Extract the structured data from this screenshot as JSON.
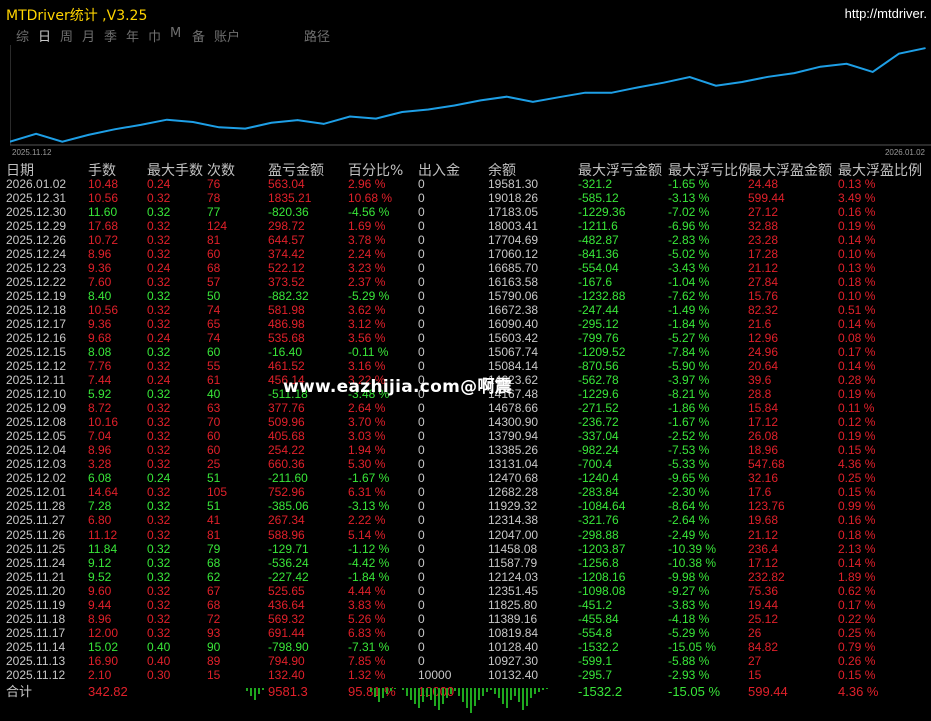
{
  "window": {
    "title": "MTDriver统计 ,V3.25",
    "url": "http://mtdriver."
  },
  "tabs": [
    "综",
    "日",
    "周",
    "月",
    "季",
    "年",
    "巾",
    "M",
    "备",
    "账户",
    "路径"
  ],
  "active_tab": 1,
  "chart_data": {
    "type": "line",
    "x_start_label": "2025.11.12",
    "x_end_label": "2026.01.02",
    "x": [
      "2025.11.12",
      "2025.11.13",
      "2025.11.14",
      "2025.11.17",
      "2025.11.18",
      "2025.11.19",
      "2025.11.20",
      "2025.11.21",
      "2025.11.24",
      "2025.11.25",
      "2025.11.26",
      "2025.11.27",
      "2025.11.28",
      "2025.12.01",
      "2025.12.02",
      "2025.12.03",
      "2025.12.04",
      "2025.12.05",
      "2025.12.08",
      "2025.12.09",
      "2025.12.10",
      "2025.12.11",
      "2025.12.12",
      "2025.12.15",
      "2025.12.16",
      "2025.12.17",
      "2025.12.18",
      "2025.12.19",
      "2025.12.22",
      "2025.12.23",
      "2025.12.24",
      "2025.12.26",
      "2025.12.29",
      "2025.12.30",
      "2025.12.31",
      "2026.01.02"
    ],
    "values": [
      10132.4,
      10927.3,
      10128.4,
      10819.84,
      11389.16,
      11825.8,
      12351.45,
      12124.03,
      11587.79,
      11458.08,
      12047.0,
      12314.38,
      11929.32,
      12682.28,
      12470.68,
      13131.04,
      13385.26,
      13790.94,
      14300.9,
      14678.66,
      14167.48,
      14623.62,
      15084.14,
      15067.74,
      15603.42,
      16090.4,
      16672.38,
      15790.06,
      16163.58,
      16685.7,
      17060.12,
      17704.69,
      18003.41,
      17183.05,
      19018.26,
      19581.3
    ],
    "ylim": [
      9800,
      19900
    ],
    "line_color": "#1e9fe6"
  },
  "headers": [
    "日期",
    "手数",
    "最大手数",
    "次数",
    "盈亏金额",
    "百分比%",
    "出入金",
    "余额",
    "最大浮亏金额",
    "最大浮亏比例",
    "最大浮盈金额",
    "最大浮盈比例"
  ],
  "rows": [
    [
      "2026.01.02",
      "10.48",
      "0.24",
      "76",
      "563.04",
      "2.96 %",
      "0",
      "19581.30",
      "-321.2",
      "-1.65 %",
      "24.48",
      "0.13 %"
    ],
    [
      "2025.12.31",
      "10.56",
      "0.32",
      "78",
      "1835.21",
      "10.68 %",
      "0",
      "19018.26",
      "-585.12",
      "-3.13 %",
      "599.44",
      "3.49 %"
    ],
    [
      "2025.12.30",
      "11.60",
      "0.32",
      "77",
      "-820.36",
      "-4.56 %",
      "0",
      "17183.05",
      "-1229.36",
      "-7.02 %",
      "27.12",
      "0.16 %"
    ],
    [
      "2025.12.29",
      "17.68",
      "0.32",
      "124",
      "298.72",
      "1.69 %",
      "0",
      "18003.41",
      "-1211.6",
      "-6.96 %",
      "32.88",
      "0.19 %"
    ],
    [
      "2025.12.26",
      "10.72",
      "0.32",
      "81",
      "644.57",
      "3.78 %",
      "0",
      "17704.69",
      "-482.87",
      "-2.83 %",
      "23.28",
      "0.14 %"
    ],
    [
      "2025.12.24",
      "8.96",
      "0.32",
      "60",
      "374.42",
      "2.24 %",
      "0",
      "17060.12",
      "-841.36",
      "-5.02 %",
      "17.28",
      "0.10 %"
    ],
    [
      "2025.12.23",
      "9.36",
      "0.24",
      "68",
      "522.12",
      "3.23 %",
      "0",
      "16685.70",
      "-554.04",
      "-3.43 %",
      "21.12",
      "0.13 %"
    ],
    [
      "2025.12.22",
      "7.60",
      "0.32",
      "57",
      "373.52",
      "2.37 %",
      "0",
      "16163.58",
      "-167.6",
      "-1.04 %",
      "27.84",
      "0.18 %"
    ],
    [
      "2025.12.19",
      "8.40",
      "0.32",
      "50",
      "-882.32",
      "-5.29 %",
      "0",
      "15790.06",
      "-1232.88",
      "-7.62 %",
      "15.76",
      "0.10 %"
    ],
    [
      "2025.12.18",
      "10.56",
      "0.32",
      "74",
      "581.98",
      "3.62 %",
      "0",
      "16672.38",
      "-247.44",
      "-1.49 %",
      "82.32",
      "0.51 %"
    ],
    [
      "2025.12.17",
      "9.36",
      "0.32",
      "65",
      "486.98",
      "3.12 %",
      "0",
      "16090.40",
      "-295.12",
      "-1.84 %",
      "21.6",
      "0.14 %"
    ],
    [
      "2025.12.16",
      "9.68",
      "0.24",
      "74",
      "535.68",
      "3.56 %",
      "0",
      "15603.42",
      "-799.76",
      "-5.27 %",
      "12.96",
      "0.08 %"
    ],
    [
      "2025.12.15",
      "8.08",
      "0.32",
      "60",
      "-16.40",
      "-0.11 %",
      "0",
      "15067.74",
      "-1209.52",
      "-7.84 %",
      "24.96",
      "0.17 %"
    ],
    [
      "2025.12.12",
      "7.76",
      "0.32",
      "55",
      "461.52",
      "3.16 %",
      "0",
      "15084.14",
      "-870.56",
      "-5.90 %",
      "20.64",
      "0.14 %"
    ],
    [
      "2025.12.11",
      "7.44",
      "0.24",
      "61",
      "456.14",
      "3.22 %",
      "0",
      "14623.62",
      "-562.78",
      "-3.97 %",
      "39.6",
      "0.28 %"
    ],
    [
      "2025.12.10",
      "5.92",
      "0.32",
      "40",
      "-511.18",
      "-3.48 %",
      "0",
      "14167.48",
      "-1229.6",
      "-8.21 %",
      "28.8",
      "0.19 %"
    ],
    [
      "2025.12.09",
      "8.72",
      "0.32",
      "63",
      "377.76",
      "2.64 %",
      "0",
      "14678.66",
      "-271.52",
      "-1.86 %",
      "15.84",
      "0.11 %"
    ],
    [
      "2025.12.08",
      "10.16",
      "0.32",
      "70",
      "509.96",
      "3.70 %",
      "0",
      "14300.90",
      "-236.72",
      "-1.67 %",
      "17.12",
      "0.12 %"
    ],
    [
      "2025.12.05",
      "7.04",
      "0.32",
      "60",
      "405.68",
      "3.03 %",
      "0",
      "13790.94",
      "-337.04",
      "-2.52 %",
      "26.08",
      "0.19 %"
    ],
    [
      "2025.12.04",
      "8.96",
      "0.32",
      "60",
      "254.22",
      "1.94 %",
      "0",
      "13385.26",
      "-982.24",
      "-7.53 %",
      "18.96",
      "0.15 %"
    ],
    [
      "2025.12.03",
      "3.28",
      "0.32",
      "25",
      "660.36",
      "5.30 %",
      "0",
      "13131.04",
      "-700.4",
      "-5.33 %",
      "547.68",
      "4.36 %"
    ],
    [
      "2025.12.02",
      "6.08",
      "0.24",
      "51",
      "-211.60",
      "-1.67 %",
      "0",
      "12470.68",
      "-1240.4",
      "-9.65 %",
      "32.16",
      "0.25 %"
    ],
    [
      "2025.12.01",
      "14.64",
      "0.32",
      "105",
      "752.96",
      "6.31 %",
      "0",
      "12682.28",
      "-283.84",
      "-2.30 %",
      "17.6",
      "0.15 %"
    ],
    [
      "2025.11.28",
      "7.28",
      "0.32",
      "51",
      "-385.06",
      "-3.13 %",
      "0",
      "11929.32",
      "-1084.64",
      "-8.64 %",
      "123.76",
      "0.99 %"
    ],
    [
      "2025.11.27",
      "6.80",
      "0.32",
      "41",
      "267.34",
      "2.22 %",
      "0",
      "12314.38",
      "-321.76",
      "-2.64 %",
      "19.68",
      "0.16 %"
    ],
    [
      "2025.11.26",
      "11.12",
      "0.32",
      "81",
      "588.96",
      "5.14 %",
      "0",
      "12047.00",
      "-298.88",
      "-2.49 %",
      "21.12",
      "0.18 %"
    ],
    [
      "2025.11.25",
      "11.84",
      "0.32",
      "79",
      "-129.71",
      "-1.12 %",
      "0",
      "11458.08",
      "-1203.87",
      "-10.39 %",
      "236.4",
      "2.13 %"
    ],
    [
      "2025.11.24",
      "9.12",
      "0.32",
      "68",
      "-536.24",
      "-4.42 %",
      "0",
      "11587.79",
      "-1256.8",
      "-10.38 %",
      "17.12",
      "0.14 %"
    ],
    [
      "2025.11.21",
      "9.52",
      "0.32",
      "62",
      "-227.42",
      "-1.84 %",
      "0",
      "12124.03",
      "-1208.16",
      "-9.98 %",
      "232.82",
      "1.89 %"
    ],
    [
      "2025.11.20",
      "9.60",
      "0.32",
      "67",
      "525.65",
      "4.44 %",
      "0",
      "12351.45",
      "-1098.08",
      "-9.27 %",
      "75.36",
      "0.62 %"
    ],
    [
      "2025.11.19",
      "9.44",
      "0.32",
      "68",
      "436.64",
      "3.83 %",
      "0",
      "11825.80",
      "-451.2",
      "-3.83 %",
      "19.44",
      "0.17 %"
    ],
    [
      "2025.11.18",
      "8.96",
      "0.32",
      "72",
      "569.32",
      "5.26 %",
      "0",
      "11389.16",
      "-455.84",
      "-4.18 %",
      "25.12",
      "0.22 %"
    ],
    [
      "2025.11.17",
      "12.00",
      "0.32",
      "93",
      "691.44",
      "6.83 %",
      "0",
      "10819.84",
      "-554.8",
      "-5.29 %",
      "26",
      "0.25 %"
    ],
    [
      "2025.11.14",
      "15.02",
      "0.40",
      "90",
      "-798.90",
      "-7.31 %",
      "0",
      "10128.40",
      "-1532.2",
      "-15.05 %",
      "84.82",
      "0.79 %"
    ],
    [
      "2025.11.13",
      "16.90",
      "0.40",
      "89",
      "794.90",
      "7.85 %",
      "0",
      "10927.30",
      "-599.1",
      "-5.88 %",
      "27",
      "0.26 %"
    ],
    [
      "2025.11.12",
      "2.10",
      "0.30",
      "15",
      "132.40",
      "1.32 %",
      "10000",
      "10132.40",
      "-295.7",
      "-2.93 %",
      "15",
      "0.15 %"
    ]
  ],
  "totals": [
    "合计",
    "342.82",
    "",
    "",
    "9581.3",
    "95.81 %",
    "10000",
    "",
    "-1532.2",
    "-15.05 %",
    "599.44",
    "4.36 %"
  ],
  "watermark": "www.eazhijia.com@啊震",
  "colors": {
    "positive": "#e0202a",
    "negative": "#39e639",
    "neutral": "#c8c8c8",
    "title": "#ffd400"
  }
}
